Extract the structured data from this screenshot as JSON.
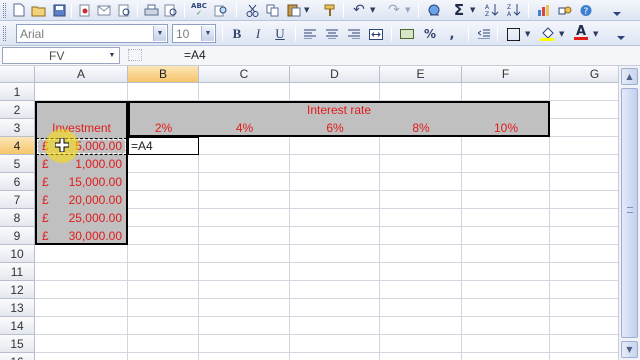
{
  "toolbar_standard": {
    "icons": [
      "new-icon",
      "open-icon",
      "save-icon",
      "permission-icon",
      "print-icon",
      "print-preview-icon",
      "spelling-icon",
      "research-icon",
      "cut-icon",
      "copy-icon",
      "paste-icon",
      "format-painter-icon",
      "undo-icon",
      "redo-icon",
      "hyperlink-icon",
      "autosum-icon",
      "sort-ascending-icon",
      "sort-descending-icon",
      "chart-wizard-icon",
      "drawing-icon",
      "zoom-icon"
    ],
    "spelling_text": "ABC",
    "autosum_glyph": "Σ"
  },
  "toolbar_formatting": {
    "font_name": "Arial",
    "font_size": "10",
    "bold": "B",
    "italic": "I",
    "underline": "U",
    "percent": "%",
    "comma": ",",
    "font_color_letter": "A",
    "font_color": "#e21a1a"
  },
  "formula_bar": {
    "name_box": "FV",
    "formula": "=A4"
  },
  "columns": [
    "A",
    "B",
    "C",
    "D",
    "E",
    "F",
    "G"
  ],
  "rows": [
    "1",
    "2",
    "3",
    "4",
    "5",
    "6",
    "7",
    "8",
    "9",
    "10",
    "11",
    "12",
    "13",
    "14",
    "15",
    "16"
  ],
  "active_cell": "B4",
  "cells": {
    "D2": "Interest rate",
    "A3": "Investment",
    "B3": "2%",
    "C3": "4%",
    "D3": "6%",
    "E3": "8%",
    "F3": "10%",
    "B4": "=A4",
    "A4": {
      "currency": "£",
      "value": "5,000.00"
    },
    "A5": {
      "currency": "£",
      "value": "1,000.00"
    },
    "A6": {
      "currency": "£",
      "value": "15,000.00"
    },
    "A7": {
      "currency": "£",
      "value": "20,000.00"
    },
    "A8": {
      "currency": "£",
      "value": "25,000.00"
    },
    "A9": {
      "currency": "£",
      "value": "30,000.00"
    }
  },
  "colors": {
    "header_fill": "#c0c0c0",
    "text_red": "#e21a1a",
    "selected_header": "#f6c56b"
  }
}
